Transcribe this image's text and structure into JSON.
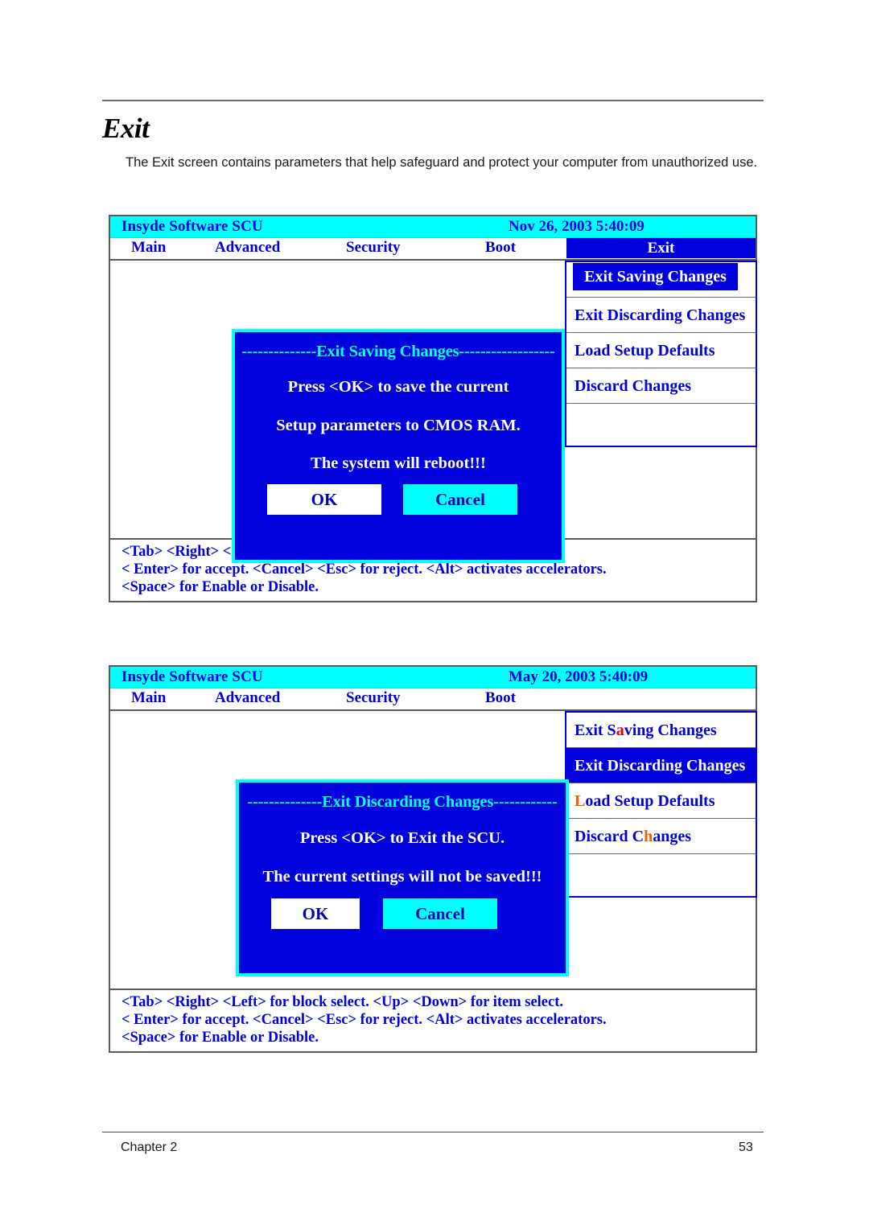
{
  "document": {
    "title": "Exit",
    "intro": "The Exit screen contains parameters that help safeguard and protect your computer from unauthorized use.",
    "footer_left": "Chapter 2",
    "footer_right": "53"
  },
  "colors": {
    "titlebar_bg": "#00FFFF",
    "accent_blue": "#0000DD",
    "dialog_bg": "#0000DD",
    "dialog_border": "#00FFFF",
    "text_white": "#FFFFFF",
    "accelerator_orange": "#F06000",
    "accelerator_red": "#E00000"
  },
  "screen1": {
    "brand": "Insyde Software SCU",
    "clock": "Nov 26, 2003 5:40:09",
    "tabs": [
      {
        "label": "Main",
        "selected": false
      },
      {
        "label": "Advanced",
        "selected": false
      },
      {
        "label": "Security",
        "selected": false
      },
      {
        "label": "Boot",
        "selected": false
      },
      {
        "label": "Exit",
        "selected": true
      }
    ],
    "menu": [
      {
        "label": "Exit Saving Changes",
        "selected": true
      },
      {
        "label": "Exit Discarding Changes",
        "selected": false
      },
      {
        "label": "Load Setup Defaults",
        "selected": false
      },
      {
        "label": "Discard Changes",
        "selected": false
      }
    ],
    "dialog": {
      "title_dashes_left": "--------------",
      "title": "Exit Saving Changes",
      "title_dashes_right": "------------------",
      "line1": "Press   <OK>   to   save   the current",
      "line2": "Setup parameters to CMOS RAM.",
      "line3": "The system will reboot!!!",
      "ok_label": "OK",
      "cancel_label": "Cancel"
    },
    "hints": [
      "<Tab> <Right> <Left> for block select.    <Up> <Down> for item select.",
      "< Enter> for accept. <Cancel> <Esc> for reject. <Alt> activates accelerators.",
      "<Space> for Enable or Disable."
    ]
  },
  "screen2": {
    "brand": "Insyde Software SCU",
    "clock": "May 20, 2003 5:40:09",
    "tabs": [
      {
        "label": "Main",
        "selected": false
      },
      {
        "label": "Advanced",
        "selected": false
      },
      {
        "label": "Security",
        "selected": false
      },
      {
        "label": "Boot",
        "selected": false
      },
      {
        "label": "",
        "selected": false
      }
    ],
    "menu": [
      {
        "label": "Exit Saving Changes",
        "accel": "a",
        "selected": false
      },
      {
        "label": "Exit Discarding Changes",
        "accel": "",
        "selected": true
      },
      {
        "label": "Load Setup Defaults",
        "accel": "L",
        "selected": false
      },
      {
        "label": "Discard Changes",
        "accel": "h",
        "selected": false
      }
    ],
    "menu_parts": {
      "item0_pre": "Exit S",
      "item0_accel": "a",
      "item0_post": "ving Changes",
      "item1_pre": "Exit Discarding Changes",
      "item1_accel": "",
      "item1_post": "",
      "item2_pre": "",
      "item2_accel": "L",
      "item2_post": "oad Setup Defaults",
      "item3_pre": "Discard C",
      "item3_accel": "h",
      "item3_post": "anges"
    },
    "dialog": {
      "title_dashes_left": "--------------",
      "title": "Exit Discarding Changes",
      "title_dashes_right": "------------",
      "line1": "Press   <OK>   to   Exit   the SCU.",
      "line2": "The current settings will not be saved!!!",
      "ok_label": "OK",
      "cancel_label": "Cancel"
    },
    "hints": [
      "<Tab> <Right> <Left> for block select.    <Up> <Down> for item select.",
      "< Enter> for accept. <Cancel> <Esc> for reject. <Alt> activates accelerators.",
      "<Space> for Enable or Disable."
    ]
  }
}
